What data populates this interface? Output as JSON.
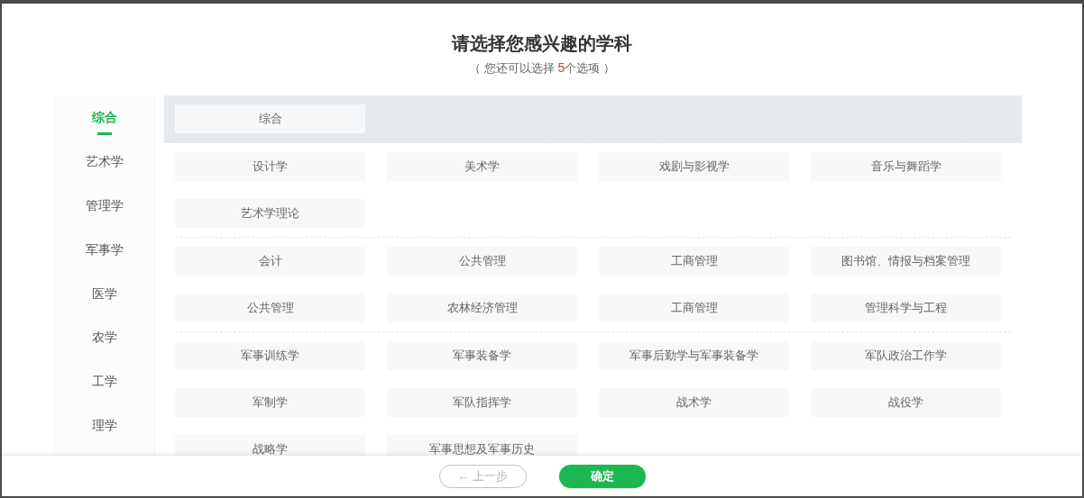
{
  "dialog": {
    "title": "请选择您感兴趣的学科",
    "subtitle_prefix": "（ 您还可以选择 ",
    "remaining_count": "5",
    "subtitle_suffix": "个选项 ）"
  },
  "sidebar": {
    "items": [
      {
        "label": "综合",
        "selected": true
      },
      {
        "label": "艺术学",
        "selected": false
      },
      {
        "label": "管理学",
        "selected": false
      },
      {
        "label": "军事学",
        "selected": false
      },
      {
        "label": "医学",
        "selected": false
      },
      {
        "label": "农学",
        "selected": false
      },
      {
        "label": "工学",
        "selected": false
      },
      {
        "label": "理学",
        "selected": false
      }
    ]
  },
  "groups": [
    {
      "selected": true,
      "items": [
        "综合"
      ]
    },
    {
      "selected": false,
      "items": [
        "设计学",
        "美术学",
        "戏剧与影视学",
        "音乐与舞蹈学",
        "艺术学理论"
      ]
    },
    {
      "selected": false,
      "items": [
        "会计",
        "公共管理",
        "工商管理",
        "图书馆、情报与档案管理",
        "公共管理",
        "农林经济管理",
        "工商管理",
        "管理科学与工程"
      ]
    },
    {
      "selected": false,
      "items": [
        "军事训练学",
        "军事装备学",
        "军事后勤学与军事装备学",
        "军队政治工作学",
        "军制学",
        "军队指挥学",
        "战术学",
        "战役学",
        "战略学",
        "军事思想及军事历史"
      ]
    }
  ],
  "footer": {
    "back_button": "← 上一步",
    "confirm_button": "确定"
  }
}
